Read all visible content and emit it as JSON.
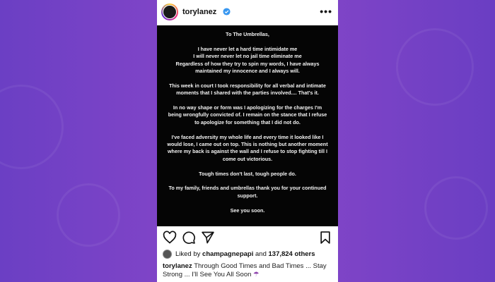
{
  "post": {
    "username": "torylanez",
    "image_text": {
      "title": "To The Umbrellas,",
      "paragraphs": [
        "I have never let a hard time intimidate me\nI will never never let no jail time eliminate me\nRegardless of how they try to spin my words, I have always maintained my innocence and I always will.",
        "This week in court I took responsibility for all verbal and intimate moments that I shared with the parties involved.... That's it.",
        "In no way shape or form was I apologizing for the charges I'm being wrongfully convicted of. I remain on the stance that I refuse to apologize for something that I did not do.",
        "I've faced adversity my whole life and every time it looked like I would lose, I came out on top. This is nothing but another moment where my back is against the wall and I refuse to stop fighting till I come out victorious.",
        "Tough times don't last, tough people do.",
        "To my family, friends and umbrellas thank you for your continued support.",
        "See you soon."
      ]
    },
    "likes": {
      "prefix": "Liked by",
      "user": "champagnepapi",
      "and": "and",
      "count": "137,824 others"
    },
    "caption": {
      "user": "torylanez",
      "text": "Through Good Times and Bad Times ... Stay Strong ... I'll See You All Soon",
      "emoji": "☂"
    }
  },
  "colors": {
    "background": "#7b43c7",
    "post_bg": "#050505",
    "verified": "#3897f0"
  },
  "icons": [
    "more-options-icon",
    "heart-icon",
    "comment-icon",
    "share-icon",
    "bookmark-icon",
    "verified-badge-icon"
  ]
}
